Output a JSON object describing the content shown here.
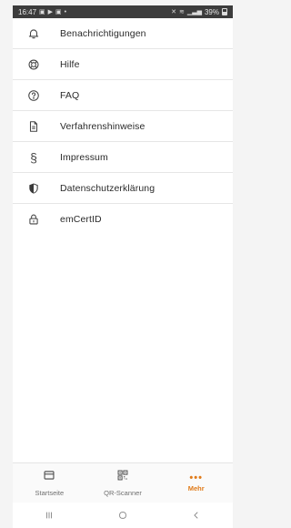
{
  "status_bar": {
    "time": "16:47",
    "left_icons": [
      "gallery-notification-icon",
      "play-notification-icon",
      "image-notification-icon",
      "dot-notification-icon"
    ],
    "right_icons": [
      "mute-icon",
      "wifi-calling-icon",
      "signal-icon"
    ],
    "battery": "39%"
  },
  "menu": {
    "items": [
      {
        "label": "Benachrichtigungen",
        "icon": "bell-icon"
      },
      {
        "label": "Hilfe",
        "icon": "lifebuoy-icon"
      },
      {
        "label": "FAQ",
        "icon": "question-circle-icon"
      },
      {
        "label": "Verfahrenshinweise",
        "icon": "document-icon"
      },
      {
        "label": "Impressum",
        "icon": "section-sign-icon"
      },
      {
        "label": "Datenschutzerklärung",
        "icon": "shield-icon"
      },
      {
        "label": "emCertID",
        "icon": "lock-icon"
      }
    ]
  },
  "bottom_nav": {
    "tabs": [
      {
        "label": "Startseite",
        "icon": "home-card-icon",
        "active": false
      },
      {
        "label": "QR-Scanner",
        "icon": "qr-code-icon",
        "active": false
      },
      {
        "label": "Mehr",
        "icon": "more-dots-icon",
        "active": true
      }
    ],
    "accent_color": "#e07b1a"
  },
  "system_nav": {
    "buttons": [
      "recents-button",
      "home-button",
      "back-button"
    ]
  }
}
